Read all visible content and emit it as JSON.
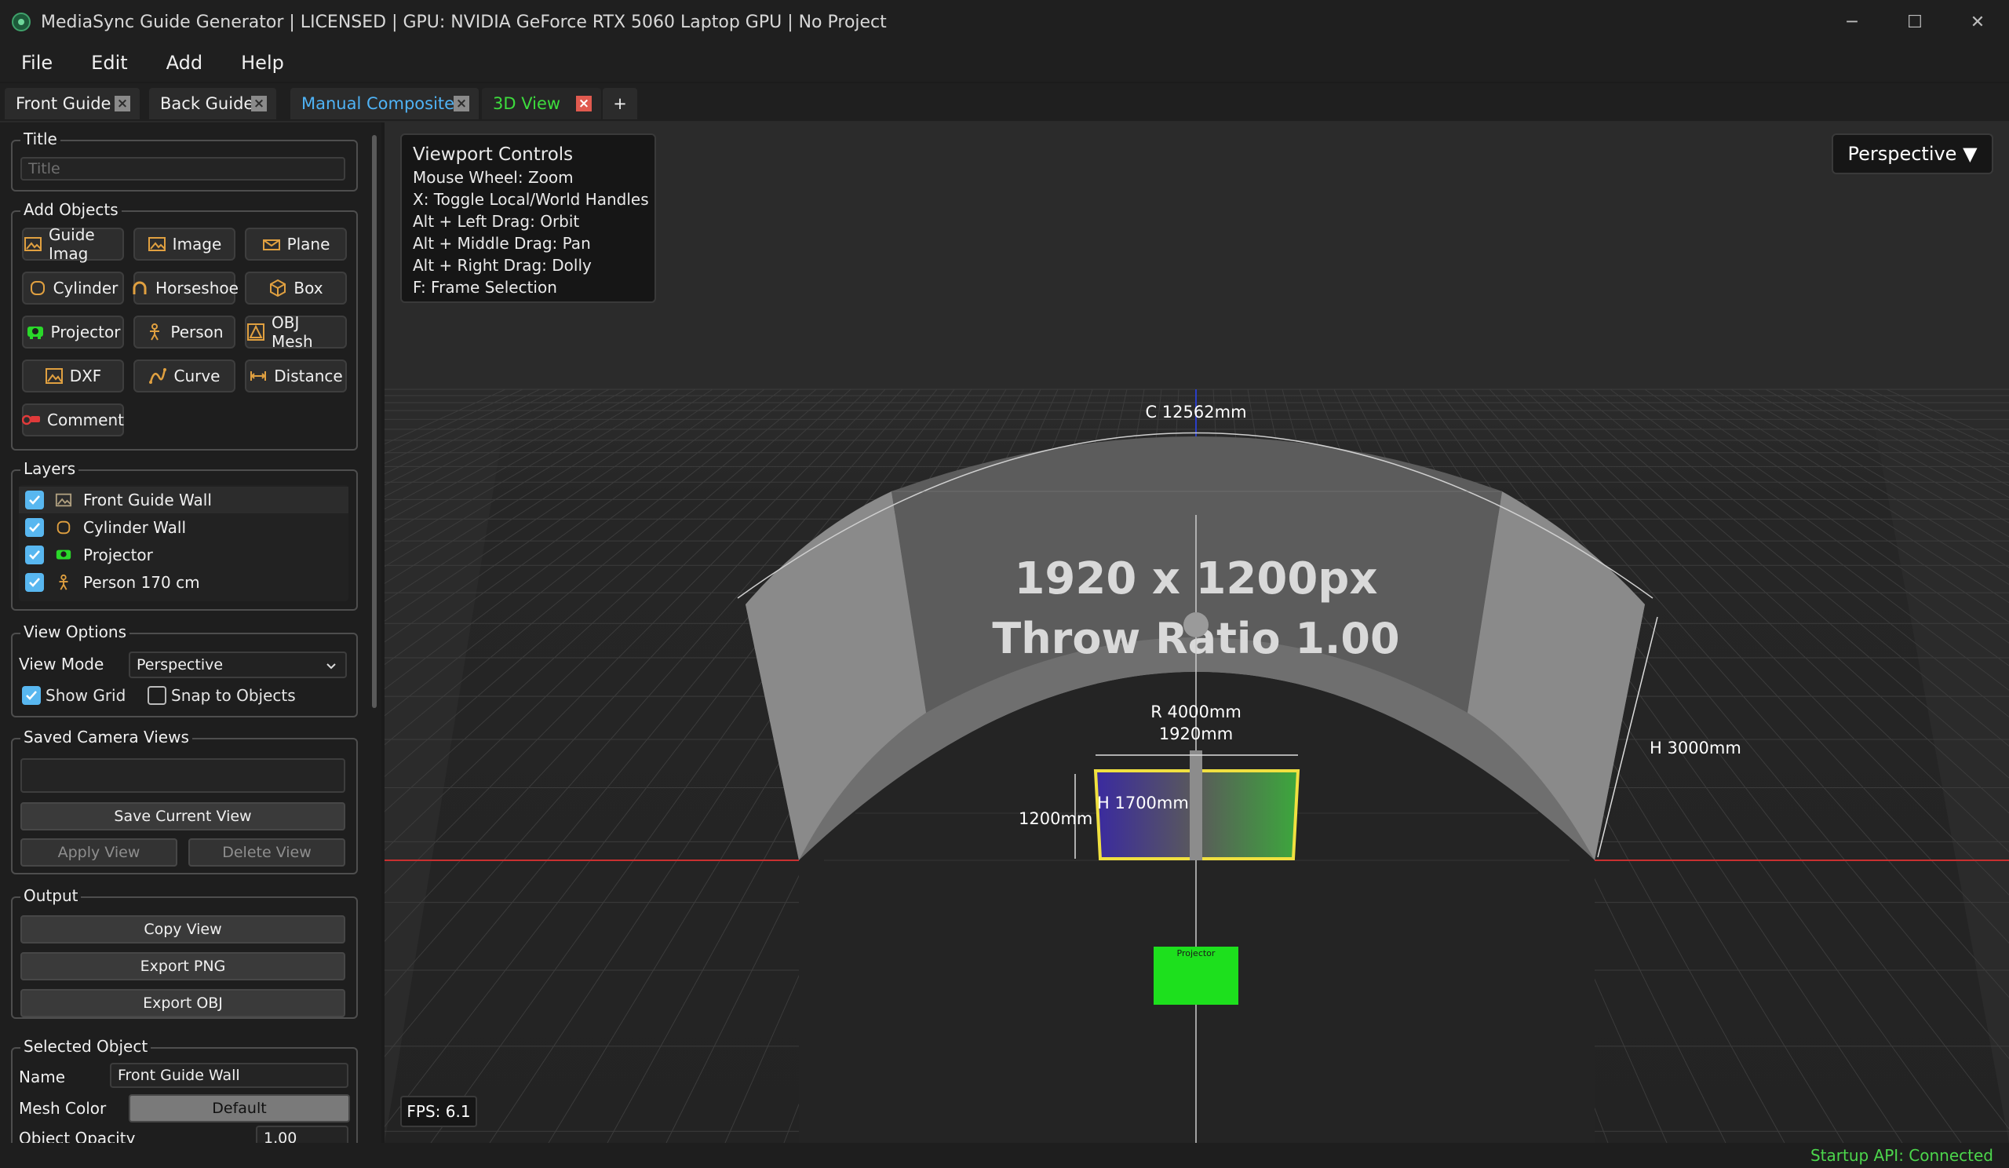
{
  "window": {
    "title": "MediaSync Guide Generator | LICENSED | GPU: NVIDIA GeForce RTX 5060 Laptop GPU | No Project",
    "controls": [
      "─",
      "☐",
      "✕"
    ]
  },
  "menu": [
    "File",
    "Edit",
    "Add",
    "Help"
  ],
  "tabs": [
    {
      "label": "Front Guide",
      "color": "#f0f0f0"
    },
    {
      "label": "Back Guide",
      "color": "#f0f0f0"
    },
    {
      "label": "Manual Composite",
      "color": "#4fb3f6"
    },
    {
      "label": "3D View",
      "color": "#3ddc3d",
      "active": true
    },
    {
      "label": "+"
    }
  ],
  "sidebar": {
    "title_group": {
      "label": "Title",
      "placeholder": "Title"
    },
    "add_objects": {
      "label": "Add Objects",
      "buttons": [
        {
          "label": "Guide Imag",
          "icon": "guide-image-icon"
        },
        {
          "label": "Image",
          "icon": "image-icon"
        },
        {
          "label": "Plane",
          "icon": "plane-icon"
        },
        {
          "label": "Cylinder",
          "icon": "cylinder-icon"
        },
        {
          "label": "Horseshoe",
          "icon": "horseshoe-icon"
        },
        {
          "label": "Box",
          "icon": "box-icon"
        },
        {
          "label": "Projector",
          "icon": "projector-icon"
        },
        {
          "label": "Person",
          "icon": "person-icon"
        },
        {
          "label": "OBJ Mesh",
          "icon": "obj-mesh-icon"
        },
        {
          "label": "DXF",
          "icon": "dxf-icon"
        },
        {
          "label": "Curve",
          "icon": "curve-icon"
        },
        {
          "label": "Distance",
          "icon": "distance-icon"
        },
        {
          "label": "Comment",
          "icon": "comment-icon"
        }
      ]
    },
    "layers": {
      "label": "Layers",
      "items": [
        {
          "label": "Front Guide Wall",
          "icon": "image-icon",
          "checked": true
        },
        {
          "label": "Cylinder Wall",
          "icon": "cylinder-icon",
          "checked": true
        },
        {
          "label": "Projector",
          "icon": "projector-icon",
          "checked": true
        },
        {
          "label": "Person 170 cm",
          "icon": "person-icon",
          "checked": true
        }
      ]
    },
    "view_options": {
      "label": "View Options",
      "view_mode_label": "View Mode",
      "view_mode_value": "Perspective",
      "show_grid_label": "Show Grid",
      "show_grid": true,
      "snap_label": "Snap to Objects",
      "snap": false
    },
    "saved_views": {
      "label": "Saved Camera Views",
      "save_label": "Save Current View",
      "apply_label": "Apply View",
      "delete_label": "Delete View"
    },
    "output": {
      "label": "Output",
      "copy_label": "Copy View",
      "png_label": "Export PNG",
      "obj_label": "Export OBJ"
    },
    "selected_object": {
      "label": "Selected Object",
      "name_label": "Name",
      "name_value": "Front Guide Wall",
      "mesh_color_label": "Mesh Color",
      "mesh_color_value": "Default",
      "opacity_label": "Object Opacity",
      "opacity_value": "1.00"
    }
  },
  "viewport": {
    "controls": {
      "title": "Viewport Controls",
      "lines": [
        "Mouse Wheel: Zoom",
        "X: Toggle Local/World Handles",
        "Alt + Left Drag: Orbit",
        "Alt + Middle Drag: Pan",
        "Alt + Right Drag: Dolly",
        "F: Frame Selection"
      ]
    },
    "projection": "Perspective ▼",
    "fps": "FPS: 6.1",
    "wall_text_1": "1920 x 1200px",
    "wall_text_2": "Throw Ratio 1.00",
    "dim_circumference": "C 12562mm",
    "dim_radius": "R 4000mm",
    "dim_width": "1920mm",
    "dim_height_wall": "H 3000mm",
    "dim_height_person": "H 1700mm",
    "dim_box_height": "1200mm",
    "projector_label": "Projector"
  },
  "status": {
    "text": "Startup API: Connected"
  }
}
